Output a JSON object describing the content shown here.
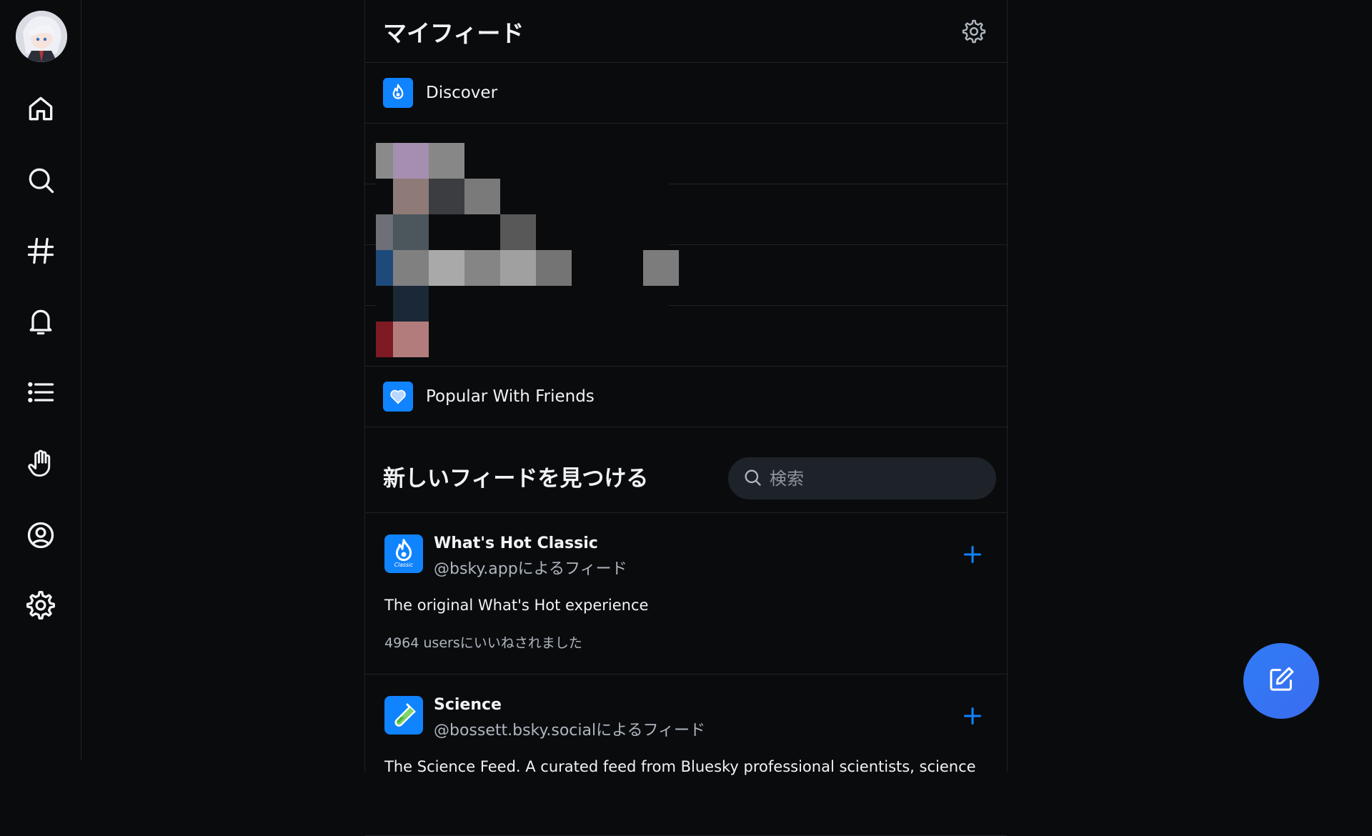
{
  "nav": {
    "items": [
      {
        "icon": "home-icon"
      },
      {
        "icon": "search-icon"
      },
      {
        "icon": "hashtag-icon"
      },
      {
        "icon": "bell-icon"
      },
      {
        "icon": "list-icon"
      },
      {
        "icon": "hand-icon"
      },
      {
        "icon": "profile-icon"
      },
      {
        "icon": "gear-icon"
      }
    ]
  },
  "header": {
    "title": "マイフィード"
  },
  "my_feeds": [
    {
      "label": "Discover",
      "icon": "flame-icon"
    },
    {
      "label": "Popular With Friends",
      "icon": "heart-icon"
    }
  ],
  "discover": {
    "title": "新しいフィードを見つける",
    "search_placeholder": "検索"
  },
  "cards": [
    {
      "name": "What's Hot Classic",
      "by": "@bsky.appによるフィード",
      "description": "The original What's Hot experience",
      "likes": "4964 usersにいいねされました",
      "icon_badge": "Classic"
    },
    {
      "name": "Science",
      "by": "@bossett.bsky.socialによるフィード",
      "description": "The Science Feed. A curated feed from Bluesky professional scientists,  science"
    }
  ],
  "colors": {
    "background": "#0a0b0d",
    "accent": "#1083fe",
    "border": "#1e2329"
  }
}
